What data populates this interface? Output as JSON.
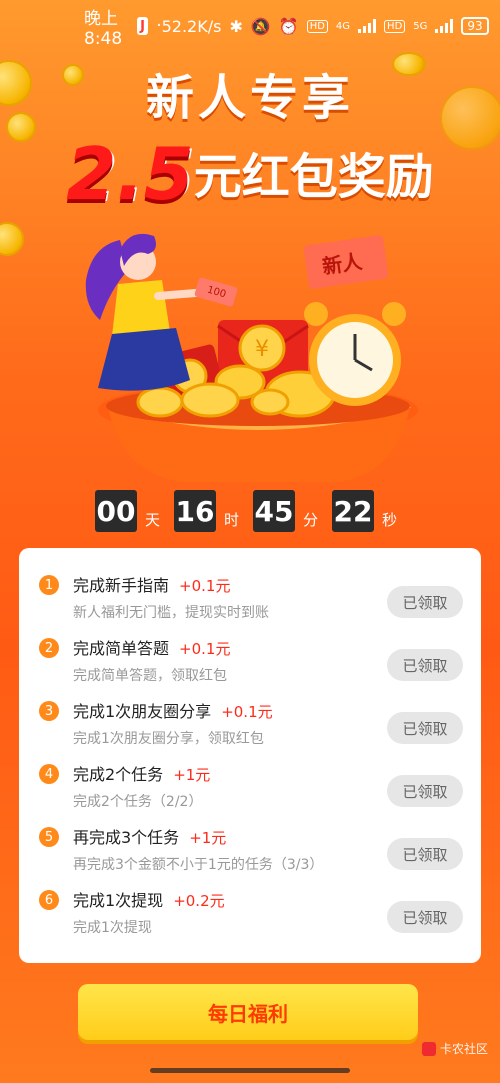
{
  "status_bar": {
    "time": "晚上8:48",
    "app_badge": "J",
    "network_speed": "52.2K/s",
    "hd1": "HD",
    "net1": "4G",
    "hd2": "HD",
    "net2": "5G",
    "battery": "93"
  },
  "header": {
    "title_line1": "新人专享",
    "amount": "2.5",
    "title_line2_suffix": "元红包奖励"
  },
  "hero": {
    "new_user_tag": "新人",
    "note_value": "100"
  },
  "countdown": {
    "days": "00",
    "days_unit": "天",
    "hours": "16",
    "hours_unit": "时",
    "minutes": "45",
    "minutes_unit": "分",
    "seconds": "22",
    "seconds_unit": "秒"
  },
  "tasks": [
    {
      "num": "1",
      "title": "完成新手指南",
      "reward": "+0.1元",
      "desc": "新人福利无门槛，提现实时到账",
      "button": "已领取"
    },
    {
      "num": "2",
      "title": "完成简单答题",
      "reward": "+0.1元",
      "desc": "完成简单答题，领取红包",
      "button": "已领取"
    },
    {
      "num": "3",
      "title": "完成1次朋友圈分享",
      "reward": "+0.1元",
      "desc": "完成1次朋友圈分享，领取红包",
      "button": "已领取"
    },
    {
      "num": "4",
      "title": "完成2个任务",
      "reward": "+1元",
      "desc": "完成2个任务（2/2）",
      "button": "已领取"
    },
    {
      "num": "5",
      "title": "再完成3个任务",
      "reward": "+1元",
      "desc": "再完成3个金额不小于1元的任务（3/3）",
      "button": "已领取"
    },
    {
      "num": "6",
      "title": "完成1次提现",
      "reward": "+0.2元",
      "desc": "完成1次提现",
      "button": "已领取"
    }
  ],
  "daily_button": "每日福利",
  "watermark": "卡农社区",
  "colors": {
    "accent": "#ff6a1a",
    "reward": "#ff2b1a",
    "button_yellow": "#ffd21a"
  }
}
